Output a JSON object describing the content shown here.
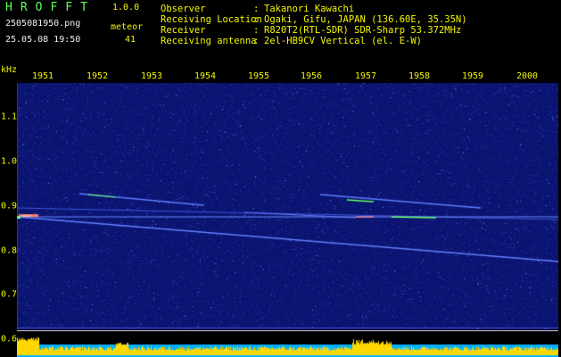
{
  "app": {
    "title": "HROFFT",
    "version": "1.0.0"
  },
  "capture": {
    "filename": "2505081950.png",
    "datetime": "25.05.08 19:50",
    "meteor_label": "meteor",
    "meteor_count": "41"
  },
  "info": [
    {
      "key": "Observer",
      "sep": ":",
      "value": "Takanori Kawachi"
    },
    {
      "key": "Receiving Location",
      "sep": ":",
      "value": "Ogaki, Gifu, JAPAN (136.60E, 35.35N)"
    },
    {
      "key": "Receiver",
      "sep": ":",
      "value": "R820T2(RTL-SDR) SDR-Sharp 53.372MHz"
    },
    {
      "key": "Receiving antenna",
      "sep": ":",
      "value": "2el-HB9CV Vertical (el. E-W)"
    }
  ],
  "spectrogram": {
    "y_unit": "kHz",
    "time_ticks": [
      "1951",
      "1952",
      "1953",
      "1954",
      "1955",
      "1956",
      "1957",
      "1958",
      "1959",
      "2000"
    ],
    "freq_ticks": [
      "1.1",
      "1.0",
      "0.9",
      "0.8",
      "0.7",
      "0.6"
    ],
    "freq_range_khz": [
      0.6,
      1.15
    ],
    "colors": {
      "background": "#0b1470",
      "noise": "#3040c0",
      "trace": "#80a0ff",
      "hot": "#60ff60",
      "band": "#00b0ff",
      "band_peak": "#ffd800"
    }
  }
}
